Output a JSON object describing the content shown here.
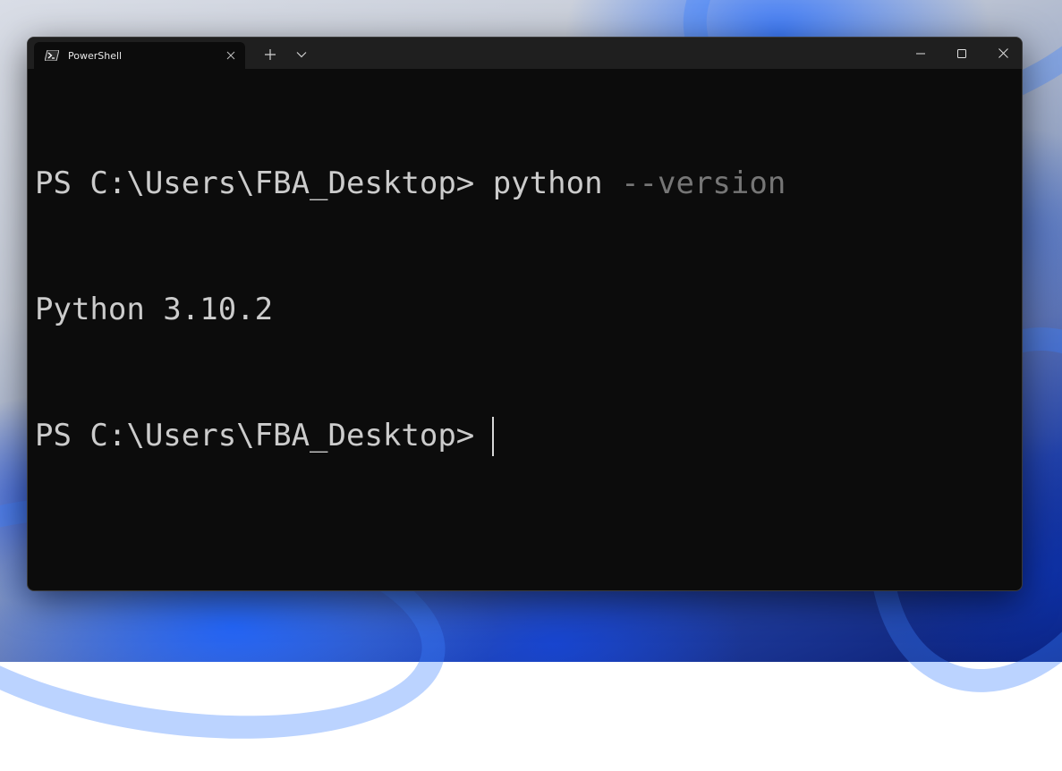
{
  "window": {
    "tab_title": "PowerShell",
    "tab_icon": "powershell-icon",
    "new_tab_icon": "plus-icon",
    "dropdown_icon": "chevron-down-icon",
    "minimize_icon": "minimize-icon",
    "maximize_icon": "maximize-icon",
    "close_icon": "close-icon"
  },
  "terminal": {
    "lines": [
      {
        "prompt": "PS C:\\Users\\FBA_Desktop>",
        "command": "python",
        "argument": "--version"
      },
      {
        "output": "Python 3.10.2"
      },
      {
        "prompt": "PS C:\\Users\\FBA_Desktop>"
      }
    ]
  },
  "colors": {
    "terminal_bg": "#0c0c0c",
    "titlebar_bg": "#1f1f1f",
    "text": "#cccccc",
    "argument_text": "#767676"
  }
}
